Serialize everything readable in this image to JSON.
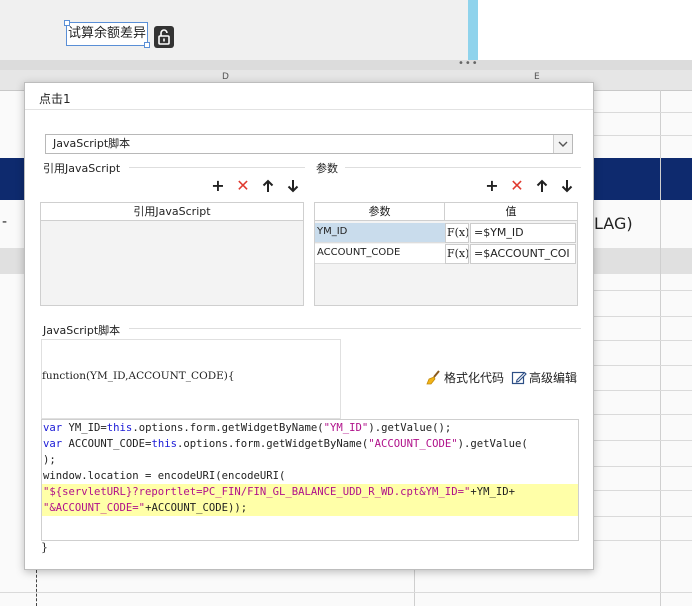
{
  "background": {
    "widget_label": "试算余额差异",
    "col_letter_1": "D",
    "col_letter_2": "E",
    "cell_text_flag": "LAG)",
    "cell_text_dash": "-"
  },
  "dialog": {
    "title": "点击1",
    "type_select": "JavaScript脚本",
    "ref_section_title": "引用JavaScript",
    "ref_table_header": "引用JavaScript",
    "params_section_title": "参数",
    "params_header_name": "参数",
    "params_header_value": "值",
    "params": [
      {
        "name": "YM_ID",
        "fx": "F(x)",
        "value": "=$YM_ID"
      },
      {
        "name": "ACCOUNT_CODE",
        "fx": "F(x)",
        "value": "=$ACCOUNT_COI"
      }
    ],
    "script_section_title": "JavaScript脚本",
    "function_signature": "function(YM_ID,ACCOUNT_CODE){",
    "format_code_label": "格式化代码",
    "advanced_edit_label": "高级编辑",
    "closing_brace": "}",
    "code_lines": [
      {
        "a": "var",
        "b": " YM_ID=",
        "c": "this",
        "d": ".options.form.getWidgetByName(",
        "e": "\"YM_ID\"",
        "f": ").getValue();"
      },
      {
        "a": "var",
        "b": " ACCOUNT_CODE=",
        "c": "this",
        "d": ".options.form.getWidgetByName(",
        "e": "\"ACCOUNT_CODE\"",
        "f": ").getValue("
      }
    ],
    "code_line3": ");",
    "code_line4_a": "window.location = encodeURI(encodeURI(",
    "code_line5_a": "\"${servletURL}?reportlet=PC_FIN/FIN_GL_BALANCE_UDD_R_WD.cpt&YM_ID=\"",
    "code_line5_b": "+YM_ID+",
    "code_line6_a": "\"&ACCOUNT_CODE=\"",
    "code_line6_b": "+ACCOUNT_CODE));"
  },
  "icons": {
    "add": "plus-icon",
    "delete": "delete-icon",
    "up": "arrow-up-icon",
    "down": "arrow-down-icon",
    "broom": "broom-icon",
    "edit": "edit-icon",
    "lock": "lock-open-icon"
  }
}
